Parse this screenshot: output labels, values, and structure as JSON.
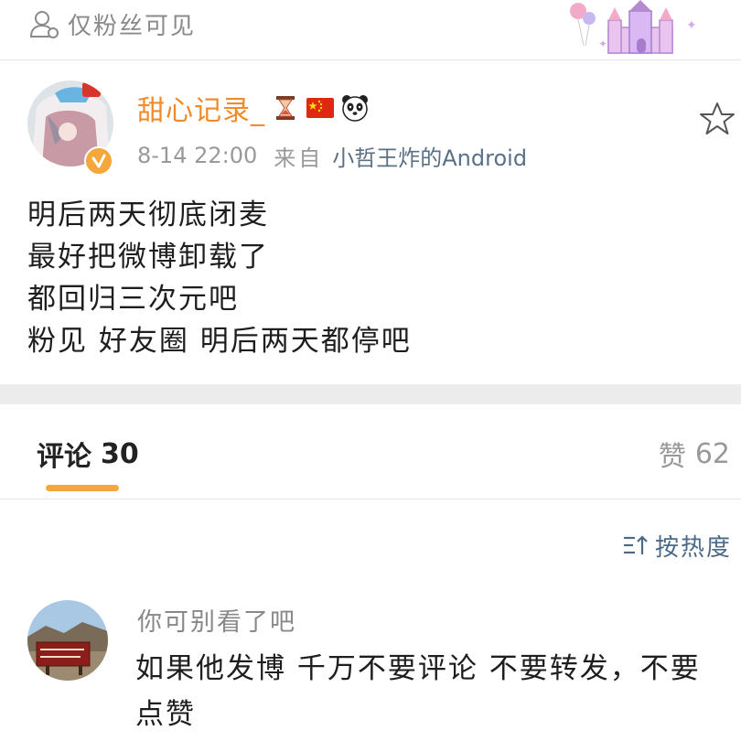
{
  "visibility": {
    "label": "仅粉丝可见"
  },
  "post": {
    "username": "甜心记录_",
    "time": "8-14 22:00",
    "from_label": "来自",
    "source": "小哲王炸的Android",
    "lines": [
      "明后两天彻底闭麦",
      "最好把微博卸载了",
      "都回归三次元吧",
      "粉见 好友圈 明后两天都停吧"
    ]
  },
  "tabs": {
    "comments_label": "评论",
    "comments_count": "30",
    "likes_label": "赞",
    "likes_count": "62"
  },
  "sort": {
    "label": "按热度"
  },
  "comment": {
    "name": "你可别看了吧",
    "lines": [
      "如果他发博 千万不要评论 不要转发，不要",
      "点赞"
    ]
  },
  "colors": {
    "accent": "#f4a73a",
    "username": "#f08b2b",
    "link": "#5a7086"
  },
  "icons": [
    "user-outline-icon",
    "castle-sticker",
    "hourglass-badge",
    "china-flag-badge",
    "panda-badge",
    "verified-icon",
    "star-icon",
    "sort-icon"
  ]
}
